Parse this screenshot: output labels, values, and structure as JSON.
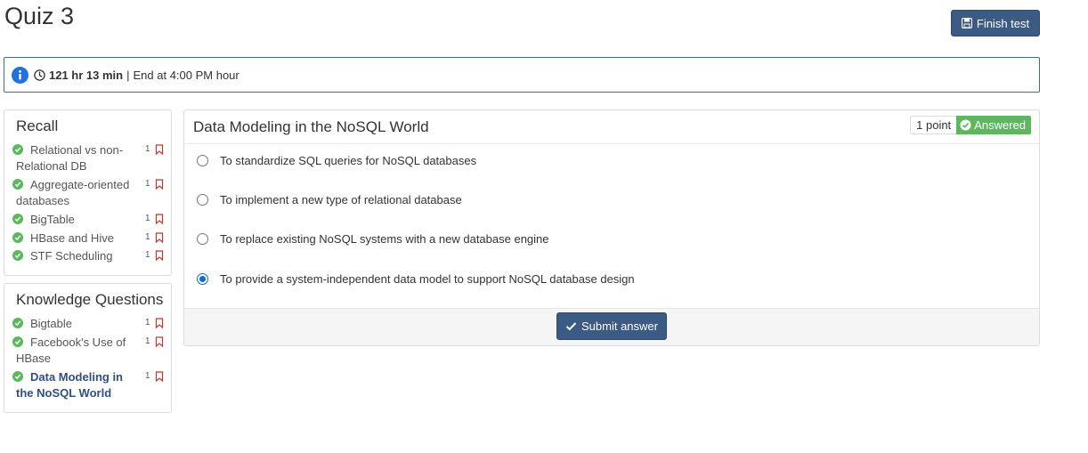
{
  "quiz": {
    "title": "Quiz 3"
  },
  "header": {
    "finish_label": "Finish test"
  },
  "timer": {
    "remaining": "121 hr 13 min",
    "separator": "|",
    "end_text": "End at 4:00 PM hour"
  },
  "sidebar": {
    "recall": {
      "heading": "Recall",
      "items": [
        {
          "label": "Relational vs non-Relational DB",
          "points": "1"
        },
        {
          "label": "Aggregate-oriented databases",
          "points": "1"
        },
        {
          "label": "BigTable",
          "points": "1"
        },
        {
          "label": "HBase and Hive",
          "points": "1"
        },
        {
          "label": "STF Scheduling",
          "points": "1"
        }
      ]
    },
    "knowledge": {
      "heading": "Knowledge Questions",
      "items": [
        {
          "label": "Bigtable",
          "points": "1"
        },
        {
          "label": "Facebook's Use of HBase",
          "points": "1"
        },
        {
          "label": "Data Modeling in the NoSQL World",
          "points": "1"
        }
      ]
    }
  },
  "question": {
    "title": "Data Modeling in the NoSQL World",
    "points_label": "1 point",
    "status": "Answered",
    "options": [
      {
        "text": "To standardize SQL queries for NoSQL databases",
        "selected": false
      },
      {
        "text": "To implement a new type of relational database",
        "selected": false
      },
      {
        "text": "To replace existing NoSQL systems with a new database engine",
        "selected": false
      },
      {
        "text": "To provide a system-independent data model to support NoSQL database design",
        "selected": true
      }
    ],
    "submit_label": "Submit answer"
  },
  "colors": {
    "primary": "#3b5a84",
    "success": "#5cb85c",
    "info": "#1f73e0",
    "flag": "#c0392b",
    "radio": "#0a6cd6"
  }
}
